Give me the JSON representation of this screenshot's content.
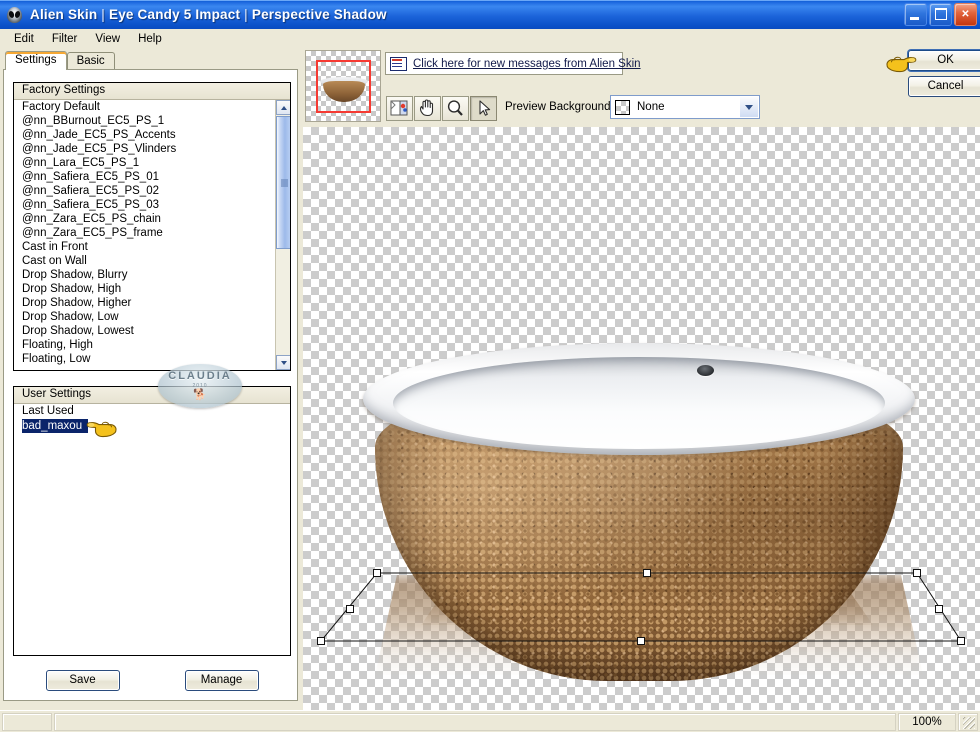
{
  "window": {
    "title_parts": [
      "Alien Skin",
      "Eye Candy 5 Impact",
      "Perspective Shadow"
    ],
    "title_full": "Alien Skin | Eye Candy 5 Impact | Perspective Shadow",
    "app_icon": "alien-head-icon",
    "controls": {
      "minimize": "Minimize",
      "maximize": "Maximize",
      "close": "Close"
    },
    "titlebar_color": "#1C64DA",
    "chrome_color": "#ece9d8"
  },
  "menubar": {
    "items": [
      {
        "label": "Edit"
      },
      {
        "label": "Filter"
      },
      {
        "label": "View"
      },
      {
        "label": "Help"
      }
    ]
  },
  "tabs": [
    {
      "label": "Settings",
      "active": true
    },
    {
      "label": "Basic",
      "active": false
    }
  ],
  "factory_settings": {
    "header": "Factory Settings",
    "items": [
      "Factory Default",
      "@nn_BBurnout_EC5_PS_1",
      "@nn_Jade_EC5_PS_Accents",
      "@nn_Jade_EC5_PS_Vlinders",
      "@nn_Lara_EC5_PS_1",
      "@nn_Safiera_EC5_PS_01",
      "@nn_Safiera_EC5_PS_02",
      "@nn_Safiera_EC5_PS_03",
      "@nn_Zara_EC5_PS_chain",
      "@nn_Zara_EC5_PS_frame",
      "Cast in Front",
      "Cast on Wall",
      "Drop Shadow, Blurry",
      "Drop Shadow, High",
      "Drop Shadow, Higher",
      "Drop Shadow, Low",
      "Drop Shadow, Lowest",
      "Floating, High",
      "Floating, Low"
    ],
    "scrollbar": {
      "up_arrow": "chevron-up-icon",
      "down_arrow": "chevron-down-icon"
    }
  },
  "user_settings": {
    "header": "User Settings",
    "items": [
      {
        "label": "Last Used",
        "selected": false
      },
      {
        "label": "bad_maxou",
        "selected": true
      }
    ],
    "selection_color": "#0a246a"
  },
  "preset_buttons": {
    "save": "Save",
    "manage": "Manage"
  },
  "message_link": {
    "icon": "message-envelope-icon",
    "text": "Click here for new messages from Alien Skin"
  },
  "preview_tools": [
    {
      "name": "compare-before-after-tool",
      "pressed": false
    },
    {
      "name": "pan-hand-tool",
      "pressed": false
    },
    {
      "name": "zoom-magnifier-tool",
      "pressed": false
    },
    {
      "name": "arrow-select-tool",
      "pressed": true
    }
  ],
  "preview_background": {
    "label": "Preview Background:",
    "value": "None",
    "swatch": "checkerboard-swatch",
    "dropdown_icon": "chevron-down-icon"
  },
  "navigator": {
    "name": "navigator-thumbnail",
    "viewport_rect_color": "#f63a32"
  },
  "dialog_buttons": {
    "ok": "OK",
    "cancel": "Cancel"
  },
  "pointers": [
    {
      "name": "hand-pointer-user-setting",
      "color": "#f2c417"
    },
    {
      "name": "hand-pointer-ok-button",
      "color": "#f2c417"
    }
  ],
  "watermark": {
    "text": "CLAUDIA",
    "subtext": "2010",
    "figure": "dog-silhouette-icon"
  },
  "canvas": {
    "name": "perspective-shadow-preview",
    "object": "textured-cork-bathtub",
    "shadow_handles": 8,
    "background": "transparency-checkerboard"
  },
  "statusbar": {
    "zoom": "100%",
    "left_text": "",
    "center_text": ""
  }
}
